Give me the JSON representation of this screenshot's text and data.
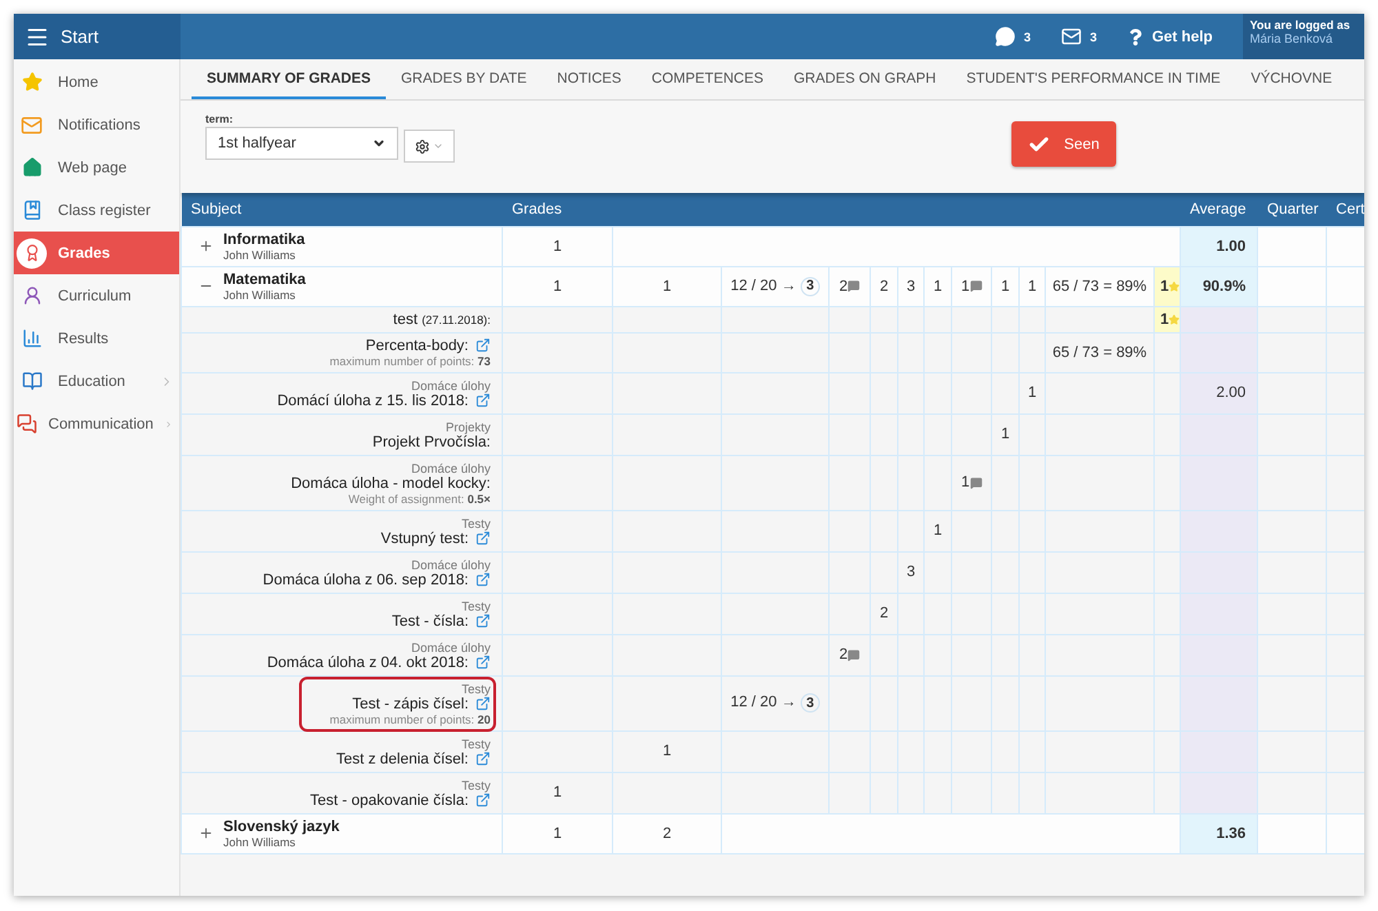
{
  "topbar": {
    "title": "Start",
    "messages_count": "3",
    "mail_count": "3",
    "help": "Get help",
    "login_label": "You are logged as",
    "user": "Mária Benková"
  },
  "sidebar": {
    "items": [
      {
        "label": "Home",
        "selected": false,
        "submenu": false
      },
      {
        "label": "Notifications",
        "selected": false,
        "submenu": false
      },
      {
        "label": "Web page",
        "selected": false,
        "submenu": false
      },
      {
        "label": "Class register",
        "selected": false,
        "submenu": false
      },
      {
        "label": "Grades",
        "selected": true,
        "submenu": false
      },
      {
        "label": "Curriculum",
        "selected": false,
        "submenu": false
      },
      {
        "label": "Results",
        "selected": false,
        "submenu": false
      },
      {
        "label": "Education",
        "selected": false,
        "submenu": true
      },
      {
        "label": "Communication",
        "selected": false,
        "submenu": true
      }
    ]
  },
  "tabs": [
    {
      "label": "SUMMARY OF GRADES",
      "selected": true
    },
    {
      "label": "GRADES BY DATE",
      "selected": false
    },
    {
      "label": "NOTICES",
      "selected": false
    },
    {
      "label": "COMPETENCES",
      "selected": false
    },
    {
      "label": "GRADES ON GRAPH",
      "selected": false
    },
    {
      "label": "STUDENT'S PERFORMANCE IN TIME",
      "selected": false
    },
    {
      "label": "VÝCHOVNE",
      "selected": false
    }
  ],
  "filter": {
    "label": "term:",
    "value": "1st halfyear",
    "seen_button": "Seen"
  },
  "table": {
    "headers": {
      "subject": "Subject",
      "grades": "Grades",
      "average": "Average",
      "quarter": "Quarter",
      "certificate": "Cert"
    },
    "rows": [
      {
        "kind": "subject",
        "name": "Informatika",
        "teacher": "John Williams",
        "expanded": false,
        "average": "1.00",
        "cells": [
          {
            "kind": "grade",
            "grade": "1",
            "comment": false
          },
          {
            "kind": "empty"
          },
          {
            "kind": "empty"
          },
          {
            "kind": "empty"
          },
          {
            "kind": "empty"
          },
          {
            "kind": "empty"
          },
          {
            "kind": "empty"
          },
          {
            "kind": "empty"
          },
          {
            "kind": "empty"
          },
          {
            "kind": "empty"
          },
          {
            "kind": "empty"
          },
          {
            "kind": "empty"
          }
        ]
      },
      {
        "kind": "subject",
        "name": "Matematika",
        "teacher": "John Williams",
        "expanded": true,
        "average": "90.9%",
        "cells": [
          {
            "kind": "grade",
            "grade": "1",
            "comment": false
          },
          {
            "kind": "grade",
            "grade": "1",
            "comment": false
          },
          {
            "kind": "points",
            "points": "12 / 20 →",
            "result": "3"
          },
          {
            "kind": "grade",
            "grade": "2",
            "comment": true
          },
          {
            "kind": "grade",
            "grade": "2",
            "comment": false
          },
          {
            "kind": "grade",
            "grade": "3",
            "comment": false
          },
          {
            "kind": "grade",
            "grade": "1",
            "comment": false
          },
          {
            "kind": "grade",
            "grade": "1",
            "comment": true
          },
          {
            "kind": "grade",
            "grade": "1",
            "comment": false
          },
          {
            "kind": "grade",
            "grade": "1",
            "comment": false
          },
          {
            "kind": "percent",
            "text": "65 / 73 = 89%"
          },
          {
            "kind": "star",
            "grade": "1"
          }
        ]
      },
      {
        "kind": "assessment",
        "title": "test",
        "date": "(27.11.2018):",
        "link": false,
        "highlighted": false,
        "cells": [
          {
            "kind": "empty"
          },
          {
            "kind": "empty"
          },
          {
            "kind": "empty"
          },
          {
            "kind": "empty"
          },
          {
            "kind": "empty"
          },
          {
            "kind": "empty"
          },
          {
            "kind": "empty"
          },
          {
            "kind": "empty"
          },
          {
            "kind": "empty"
          },
          {
            "kind": "empty"
          },
          {
            "kind": "empty"
          },
          {
            "kind": "star",
            "grade": "1"
          }
        ]
      },
      {
        "kind": "assessment",
        "title": "Percenta-body:",
        "link": true,
        "note": "maximum number of points: **73**",
        "highlighted": false,
        "cells": [
          {
            "kind": "empty"
          },
          {
            "kind": "empty"
          },
          {
            "kind": "empty"
          },
          {
            "kind": "empty"
          },
          {
            "kind": "empty"
          },
          {
            "kind": "empty"
          },
          {
            "kind": "empty"
          },
          {
            "kind": "empty"
          },
          {
            "kind": "empty"
          },
          {
            "kind": "empty"
          },
          {
            "kind": "percent",
            "text": "65 / 73 = 89%"
          },
          {
            "kind": "empty"
          }
        ]
      },
      {
        "kind": "assessment",
        "category": "Domáce úlohy",
        "title": "Domácí úloha z 15. lis 2018:",
        "link": true,
        "highlighted": false,
        "average": "2.00",
        "cells": [
          {
            "kind": "empty"
          },
          {
            "kind": "empty"
          },
          {
            "kind": "empty"
          },
          {
            "kind": "empty"
          },
          {
            "kind": "empty"
          },
          {
            "kind": "empty"
          },
          {
            "kind": "empty"
          },
          {
            "kind": "empty"
          },
          {
            "kind": "empty"
          },
          {
            "kind": "grade",
            "grade": "1",
            "comment": false
          },
          {
            "kind": "empty"
          },
          {
            "kind": "empty"
          }
        ]
      },
      {
        "kind": "assessment",
        "category": "Projekty",
        "title": "Projekt Prvočísla:",
        "link": false,
        "highlighted": false,
        "cells": [
          {
            "kind": "empty"
          },
          {
            "kind": "empty"
          },
          {
            "kind": "empty"
          },
          {
            "kind": "empty"
          },
          {
            "kind": "empty"
          },
          {
            "kind": "empty"
          },
          {
            "kind": "empty"
          },
          {
            "kind": "empty"
          },
          {
            "kind": "grade",
            "grade": "1",
            "comment": false
          },
          {
            "kind": "empty"
          },
          {
            "kind": "empty"
          },
          {
            "kind": "empty"
          }
        ]
      },
      {
        "kind": "assessment",
        "category": "Domáce úlohy",
        "title": "Domáca úloha - model kocky:",
        "link": false,
        "note": "Weight of assignment: **0.5×**",
        "highlighted": false,
        "cells": [
          {
            "kind": "empty"
          },
          {
            "kind": "empty"
          },
          {
            "kind": "empty"
          },
          {
            "kind": "empty"
          },
          {
            "kind": "empty"
          },
          {
            "kind": "empty"
          },
          {
            "kind": "empty"
          },
          {
            "kind": "grade",
            "grade": "1",
            "comment": true
          },
          {
            "kind": "empty"
          },
          {
            "kind": "empty"
          },
          {
            "kind": "empty"
          },
          {
            "kind": "empty"
          }
        ]
      },
      {
        "kind": "assessment",
        "category": "Testy",
        "title": "Vstupný test:",
        "link": true,
        "highlighted": false,
        "cells": [
          {
            "kind": "empty"
          },
          {
            "kind": "empty"
          },
          {
            "kind": "empty"
          },
          {
            "kind": "empty"
          },
          {
            "kind": "empty"
          },
          {
            "kind": "empty"
          },
          {
            "kind": "grade",
            "grade": "1",
            "comment": false
          },
          {
            "kind": "empty"
          },
          {
            "kind": "empty"
          },
          {
            "kind": "empty"
          },
          {
            "kind": "empty"
          },
          {
            "kind": "empty"
          }
        ]
      },
      {
        "kind": "assessment",
        "category": "Domáce úlohy",
        "title": "Domáca úloha z 06. sep 2018:",
        "link": true,
        "highlighted": false,
        "cells": [
          {
            "kind": "empty"
          },
          {
            "kind": "empty"
          },
          {
            "kind": "empty"
          },
          {
            "kind": "empty"
          },
          {
            "kind": "empty"
          },
          {
            "kind": "grade",
            "grade": "3",
            "comment": false
          },
          {
            "kind": "empty"
          },
          {
            "kind": "empty"
          },
          {
            "kind": "empty"
          },
          {
            "kind": "empty"
          },
          {
            "kind": "empty"
          },
          {
            "kind": "empty"
          }
        ]
      },
      {
        "kind": "assessment",
        "category": "Testy",
        "title": "Test - čísla:",
        "link": true,
        "highlighted": false,
        "cells": [
          {
            "kind": "empty"
          },
          {
            "kind": "empty"
          },
          {
            "kind": "empty"
          },
          {
            "kind": "empty"
          },
          {
            "kind": "grade",
            "grade": "2",
            "comment": false
          },
          {
            "kind": "empty"
          },
          {
            "kind": "empty"
          },
          {
            "kind": "empty"
          },
          {
            "kind": "empty"
          },
          {
            "kind": "empty"
          },
          {
            "kind": "empty"
          },
          {
            "kind": "empty"
          }
        ]
      },
      {
        "kind": "assessment",
        "category": "Domáce úlohy",
        "title": "Domáca úloha z 04. okt 2018:",
        "link": true,
        "highlighted": false,
        "cells": [
          {
            "kind": "empty"
          },
          {
            "kind": "empty"
          },
          {
            "kind": "empty"
          },
          {
            "kind": "grade",
            "grade": "2",
            "comment": true
          },
          {
            "kind": "empty"
          },
          {
            "kind": "empty"
          },
          {
            "kind": "empty"
          },
          {
            "kind": "empty"
          },
          {
            "kind": "empty"
          },
          {
            "kind": "empty"
          },
          {
            "kind": "empty"
          },
          {
            "kind": "empty"
          }
        ]
      },
      {
        "kind": "assessment",
        "category": "Testy",
        "title": "Test - zápis čísel:",
        "link": true,
        "note": "maximum number of points: **20**",
        "highlighted": true,
        "cells": [
          {
            "kind": "empty"
          },
          {
            "kind": "empty"
          },
          {
            "kind": "points",
            "points": "12 / 20 →",
            "result": "3"
          },
          {
            "kind": "empty"
          },
          {
            "kind": "empty"
          },
          {
            "kind": "empty"
          },
          {
            "kind": "empty"
          },
          {
            "kind": "empty"
          },
          {
            "kind": "empty"
          },
          {
            "kind": "empty"
          },
          {
            "kind": "empty"
          },
          {
            "kind": "empty"
          }
        ]
      },
      {
        "kind": "assessment",
        "category": "Testy",
        "title": "Test z delenia čísel:",
        "link": true,
        "highlighted": false,
        "cells": [
          {
            "kind": "empty"
          },
          {
            "kind": "grade",
            "grade": "1",
            "comment": false
          },
          {
            "kind": "empty"
          },
          {
            "kind": "empty"
          },
          {
            "kind": "empty"
          },
          {
            "kind": "empty"
          },
          {
            "kind": "empty"
          },
          {
            "kind": "empty"
          },
          {
            "kind": "empty"
          },
          {
            "kind": "empty"
          },
          {
            "kind": "empty"
          },
          {
            "kind": "empty"
          }
        ]
      },
      {
        "kind": "assessment",
        "category": "Testy",
        "title": "Test - opakovanie čísla:",
        "link": true,
        "highlighted": false,
        "cells": [
          {
            "kind": "grade",
            "grade": "1",
            "comment": false
          },
          {
            "kind": "empty"
          },
          {
            "kind": "empty"
          },
          {
            "kind": "empty"
          },
          {
            "kind": "empty"
          },
          {
            "kind": "empty"
          },
          {
            "kind": "empty"
          },
          {
            "kind": "empty"
          },
          {
            "kind": "empty"
          },
          {
            "kind": "empty"
          },
          {
            "kind": "empty"
          },
          {
            "kind": "empty"
          }
        ]
      },
      {
        "kind": "subject",
        "name": "Slovenský jazyk",
        "teacher": "John Williams",
        "expanded": false,
        "average": "1.36",
        "cells": [
          {
            "kind": "grade",
            "grade": "1",
            "comment": false
          },
          {
            "kind": "grade",
            "grade": "2",
            "comment": false
          },
          {
            "kind": "empty"
          },
          {
            "kind": "empty"
          },
          {
            "kind": "empty"
          },
          {
            "kind": "empty"
          },
          {
            "kind": "empty"
          },
          {
            "kind": "empty"
          },
          {
            "kind": "empty"
          },
          {
            "kind": "empty"
          },
          {
            "kind": "empty"
          },
          {
            "kind": "empty"
          }
        ]
      }
    ]
  }
}
